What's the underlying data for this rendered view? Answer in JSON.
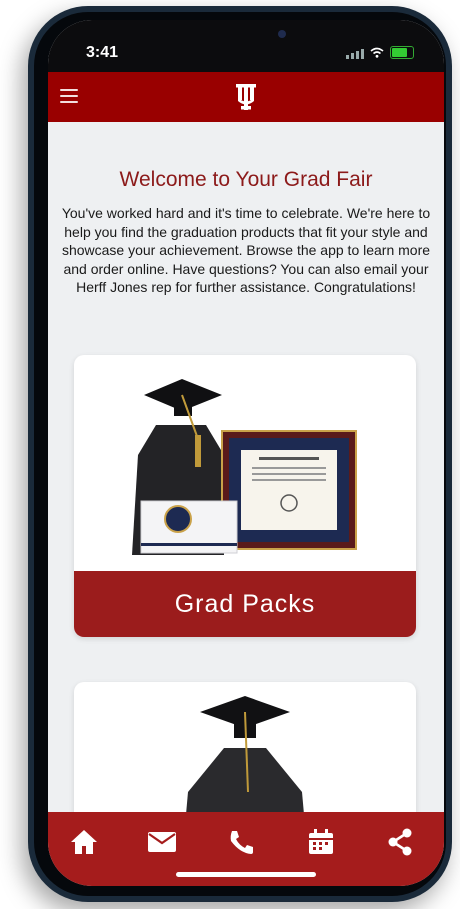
{
  "status_bar": {
    "time": "3:41"
  },
  "header": {
    "menu_icon": "hamburger-menu-icon",
    "logo_icon": "trident-logo-icon"
  },
  "page": {
    "title": "Welcome to Your Grad Fair",
    "intro": "You've worked hard and it's time to celebrate. We're here to help you find the graduation products that fit your style and showcase your achievement. Browse the app to learn more and order online. Have questions? You can also email your Herff Jones rep for further assistance. Congratulations!"
  },
  "cards": [
    {
      "label": "Grad Packs",
      "image": "grad-pack-photo"
    },
    {
      "label": "",
      "image": "cap-and-gown-photo"
    }
  ],
  "tabbar": {
    "items": [
      "home-icon",
      "mail-icon",
      "phone-icon",
      "calendar-icon",
      "share-icon"
    ]
  },
  "colors": {
    "brand": "#990000",
    "tabbar": "#a51c1c",
    "title": "#8c1a1a"
  }
}
